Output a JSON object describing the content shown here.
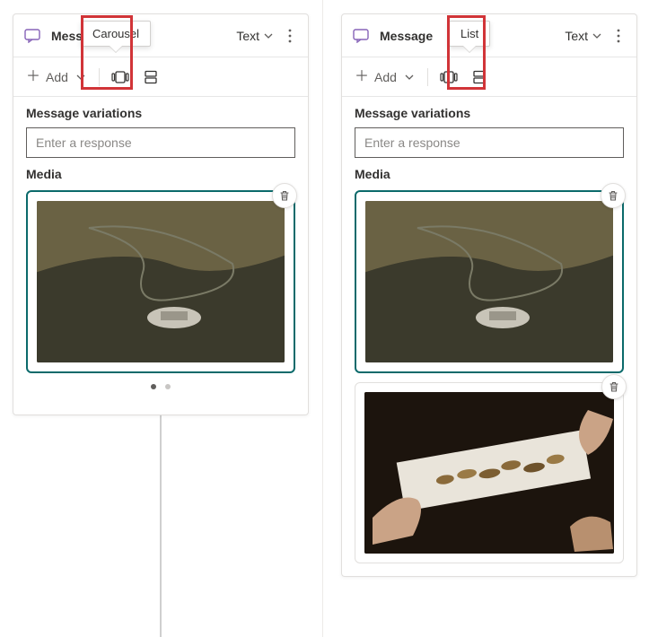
{
  "left": {
    "title": "Message",
    "text_dropdown": "Text",
    "add_label": "Add",
    "tooltip": "Carousel",
    "variations_heading": "Message variations",
    "response_placeholder": "Enter a response",
    "media_heading": "Media"
  },
  "right": {
    "title": "Message",
    "text_dropdown": "Text",
    "add_label": "Add",
    "tooltip": "List",
    "variations_heading": "Message variations",
    "response_placeholder": "Enter a response",
    "media_heading": "Media"
  }
}
